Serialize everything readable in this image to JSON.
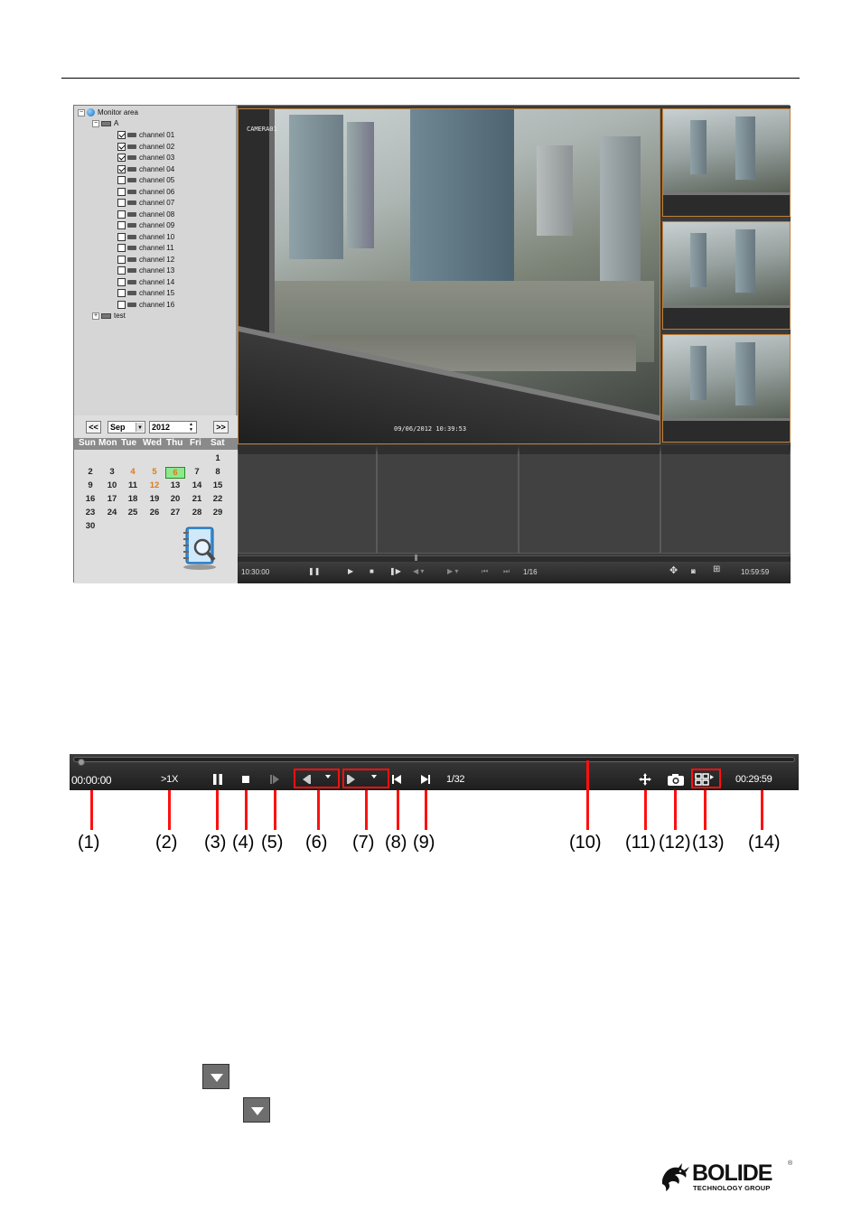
{
  "screenshot": {
    "tree": {
      "root": "Monitor area",
      "group_a": "A",
      "channels": [
        {
          "label": "channel 01",
          "checked": true
        },
        {
          "label": "channel 02",
          "checked": true
        },
        {
          "label": "channel 03",
          "checked": true
        },
        {
          "label": "channel 04",
          "checked": true
        },
        {
          "label": "channel 05",
          "checked": false
        },
        {
          "label": "channel 06",
          "checked": false
        },
        {
          "label": "channel 07",
          "checked": false
        },
        {
          "label": "channel 08",
          "checked": false
        },
        {
          "label": "channel 09",
          "checked": false
        },
        {
          "label": "channel 10",
          "checked": false
        },
        {
          "label": "channel 11",
          "checked": false
        },
        {
          "label": "channel 12",
          "checked": false
        },
        {
          "label": "channel 13",
          "checked": false
        },
        {
          "label": "channel 14",
          "checked": false
        },
        {
          "label": "channel 15",
          "checked": false
        },
        {
          "label": "channel 16",
          "checked": false
        }
      ],
      "group_test": "test"
    },
    "calendar": {
      "prev": "<<",
      "next": ">>",
      "month": "Sep",
      "year": "2012",
      "weekdays": [
        "Sun",
        "Mon",
        "Tue",
        "Wed",
        "Thu",
        "Fri",
        "Sat"
      ],
      "weeks": [
        [
          "",
          "",
          "",
          "",
          "",
          "",
          "1"
        ],
        [
          "2",
          "3",
          "4",
          "5",
          "6",
          "7",
          "8"
        ],
        [
          "9",
          "10",
          "11",
          "12",
          "13",
          "14",
          "15"
        ],
        [
          "16",
          "17",
          "18",
          "19",
          "20",
          "21",
          "22"
        ],
        [
          "23",
          "24",
          "25",
          "26",
          "27",
          "28",
          "29"
        ],
        [
          "30",
          "",
          "",
          "",
          "",
          "",
          ""
        ]
      ],
      "recorded_days": [
        "4",
        "5",
        "12"
      ],
      "selected_day": "6"
    },
    "video": {
      "camera_label": "CAMERA01",
      "timestamp": "09/06/2012 10:39:53"
    },
    "controls": {
      "start_time": "10:30:00",
      "frame_rate": "1/16",
      "end_time": "10:59:59"
    }
  },
  "control_bar": {
    "start_time": "00:00:00",
    "speed": ">1X",
    "frame_rate": "1/32",
    "end_time": "00:29:59"
  },
  "callouts": [
    "(1)",
    "(2)",
    "(3)",
    "(4)",
    "(5)",
    "(6)",
    "(7)",
    "(8)",
    "(9)",
    "(10)",
    "(11)",
    "(12)",
    "(13)",
    "(14)"
  ],
  "logo": {
    "word": "BOLIDE",
    "sub": "TECHNOLOGY GROUP",
    "registered": "®"
  }
}
